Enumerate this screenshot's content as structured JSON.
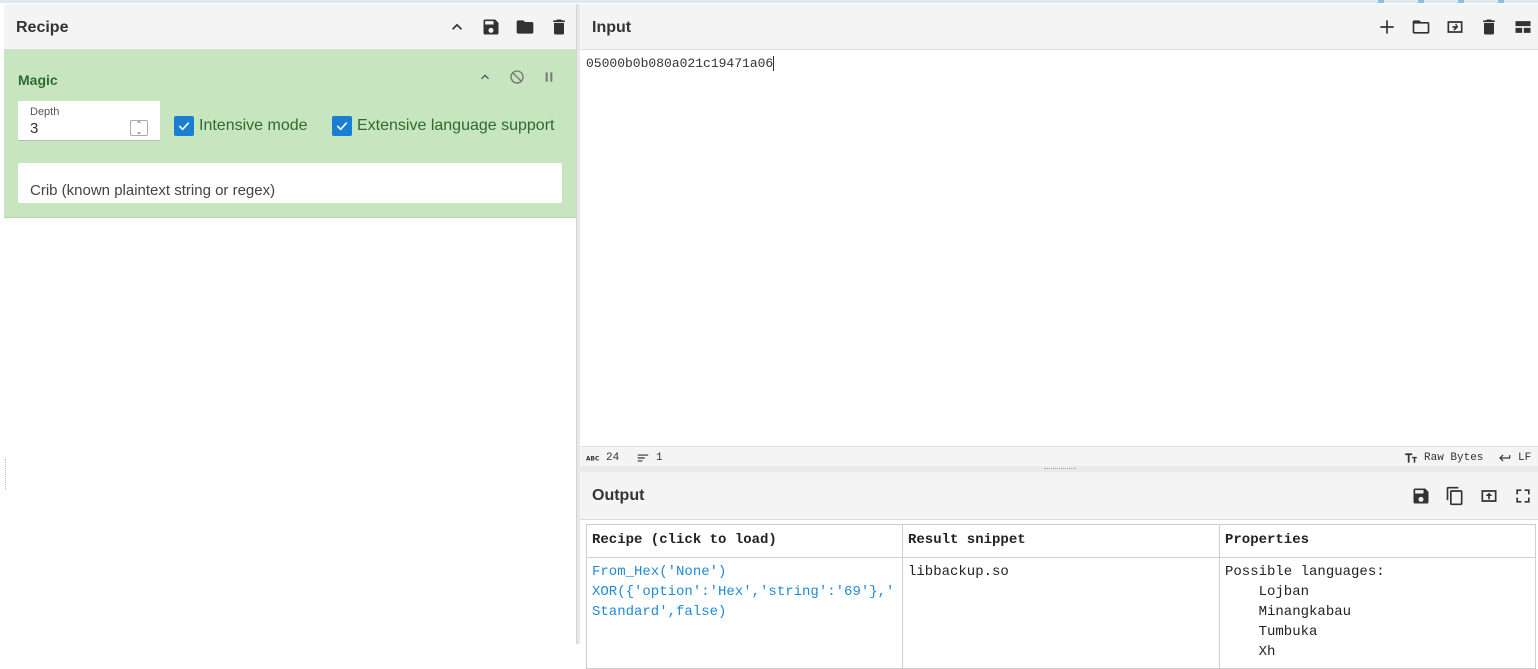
{
  "recipe": {
    "title": "Recipe",
    "operation": {
      "name": "Magic",
      "depth_label": "Depth",
      "depth_value": "3",
      "intensive_mode_label": "Intensive mode",
      "extensive_language_label": "Extensive language support",
      "crib_placeholder": "Crib (known plaintext string or regex)"
    }
  },
  "input": {
    "title": "Input",
    "text": "05000b0b080a021c19471a06",
    "status": {
      "length": "24",
      "lines": "1",
      "encoding": "Raw Bytes",
      "eol": "LF"
    }
  },
  "output": {
    "title": "Output",
    "table": {
      "headers": [
        "Recipe (click to load)",
        "Result snippet",
        "Properties"
      ],
      "rows": [
        {
          "recipe": "From_Hex('None')\nXOR({'option':'Hex','string':'69'},'\nStandard',false)",
          "snippet": "libbackup.so",
          "properties": "Possible languages:\n    Lojban\n    Minangkabau\n    Tumbuka\n    Xh"
        }
      ]
    }
  },
  "colors": {
    "operation_bg": "#c7e5bf",
    "operation_text": "#2f6b30",
    "checkbox": "#1a7fd1",
    "link": "#1f8ad6"
  }
}
